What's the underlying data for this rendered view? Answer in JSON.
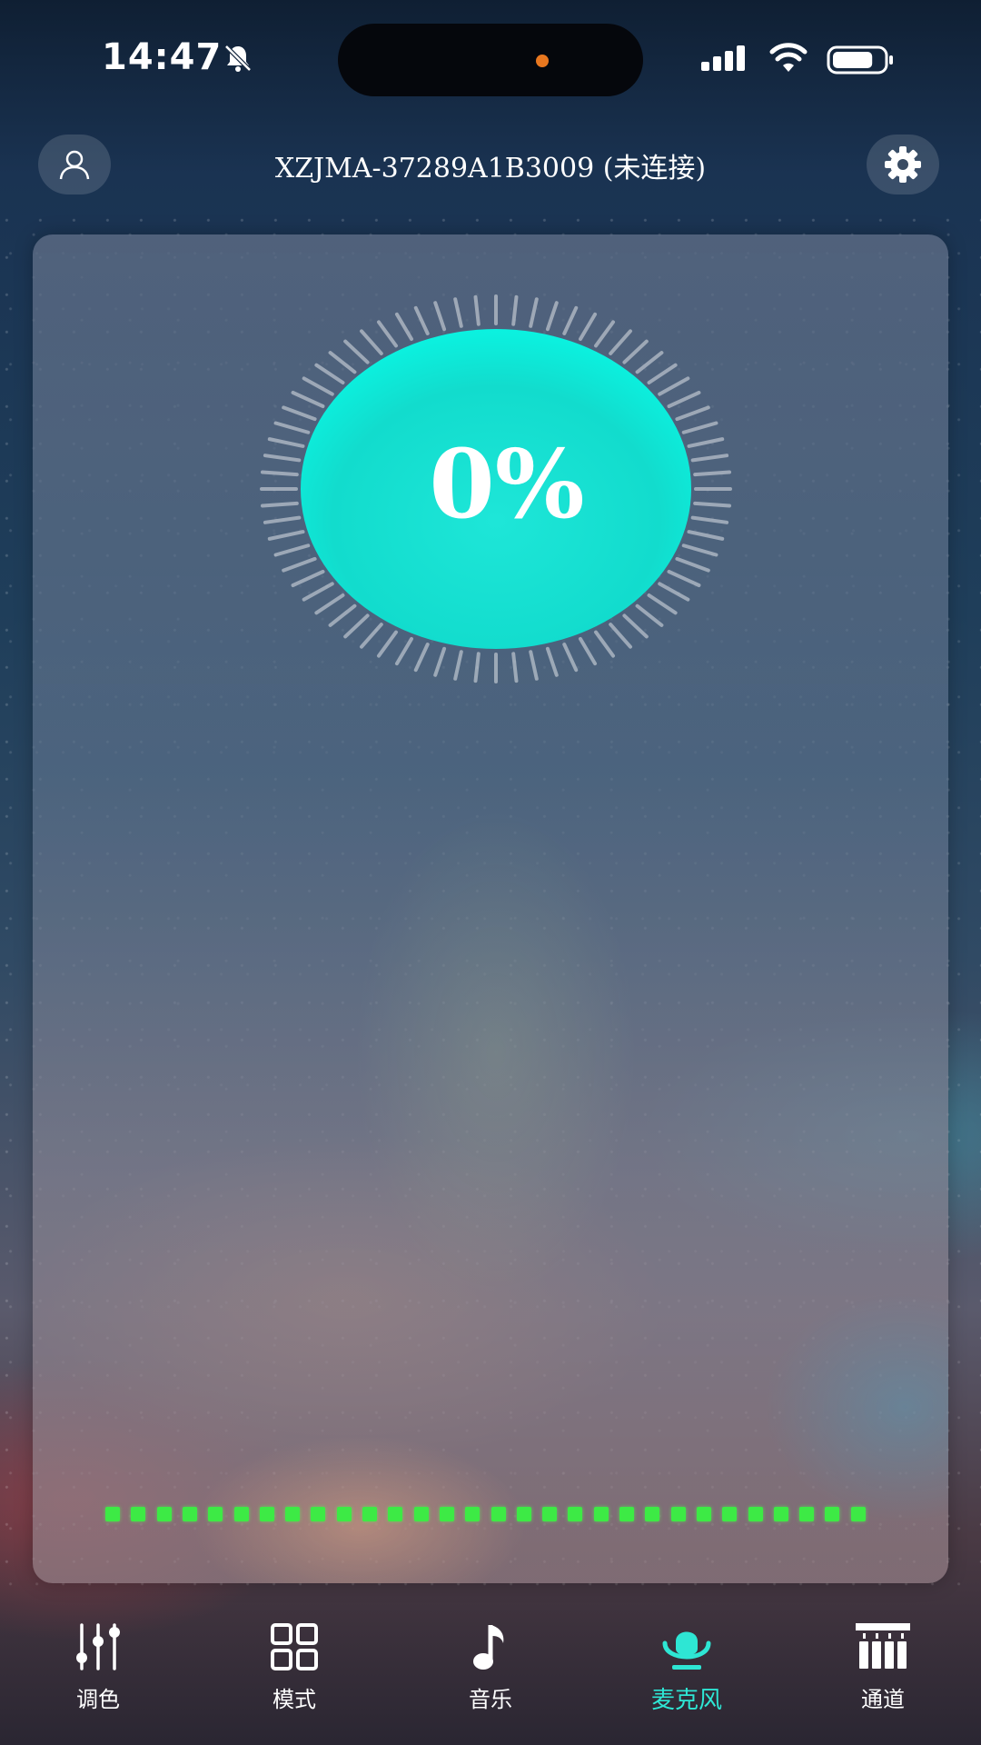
{
  "status_bar": {
    "time": "14:47",
    "icons": [
      "bell-muted-icon",
      "signal-icon",
      "wifi-icon",
      "battery-icon"
    ],
    "battery_level": 0.8
  },
  "header": {
    "device_title": "XZJMA-37289A1B3009 (未连接)",
    "left_icon": "user-icon",
    "right_icon": "gear-icon"
  },
  "gauge": {
    "value_text": "0%",
    "value": 0,
    "fill_color": "#18e8d8"
  },
  "meter": {
    "segments": 30,
    "color": "#3dea45"
  },
  "bottom_nav": {
    "active_index": 3,
    "accent_color": "#2ee6d4",
    "items": [
      {
        "label": "调色",
        "icon": "sliders-icon"
      },
      {
        "label": "模式",
        "icon": "grid-icon"
      },
      {
        "label": "音乐",
        "icon": "music-note-icon"
      },
      {
        "label": "麦克风",
        "icon": "microphone-icon"
      },
      {
        "label": "通道",
        "icon": "channels-icon"
      }
    ]
  }
}
